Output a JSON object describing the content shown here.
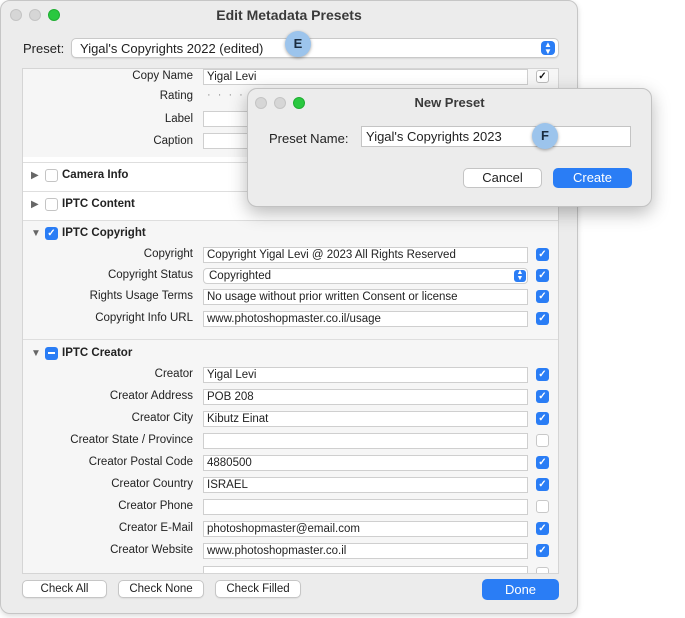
{
  "window": {
    "title": "Edit Metadata Presets"
  },
  "preset": {
    "label": "Preset:",
    "value": "Yigal's Copyrights 2022 (edited)"
  },
  "basic": {
    "copy_name": {
      "label": "Copy Name",
      "value": "Yigal Levi"
    },
    "rating": {
      "label": "Rating",
      "value": "· · · · ·"
    },
    "label": {
      "label": "Label"
    },
    "caption": {
      "label": "Caption"
    }
  },
  "sections": {
    "camera_info": "Camera Info",
    "iptc_content": "IPTC Content",
    "iptc_copyright": "IPTC Copyright",
    "iptc_creator": "IPTC Creator"
  },
  "copyright": [
    {
      "label": "Copyright",
      "value": "Copyright Yigal Levi @ 2023 All Rights Reserved",
      "checked": true
    },
    {
      "label": "Copyright Status",
      "value": "Copyrighted",
      "checked": true
    },
    {
      "label": "Rights Usage Terms",
      "value": "No usage without prior written Consent or license",
      "checked": true
    },
    {
      "label": "Copyright Info URL",
      "value": "www.photoshopmaster.co.il/usage",
      "checked": true
    }
  ],
  "creator": [
    {
      "label": "Creator",
      "value": "Yigal Levi",
      "checked": true
    },
    {
      "label": "Creator Address",
      "value": "POB 208",
      "checked": true
    },
    {
      "label": "Creator City",
      "value": "Kibutz Einat",
      "checked": true
    },
    {
      "label": "Creator State / Province",
      "value": "",
      "checked": false
    },
    {
      "label": "Creator Postal Code",
      "value": "4880500",
      "checked": true
    },
    {
      "label": "Creator Country",
      "value": "ISRAEL",
      "checked": true
    },
    {
      "label": "Creator Phone",
      "value": "",
      "checked": false
    },
    {
      "label": "Creator E-Mail",
      "value": "photoshopmaster@email.com",
      "checked": true
    },
    {
      "label": "Creator Website",
      "value": "www.photoshopmaster.co.il",
      "checked": true
    }
  ],
  "buttons": {
    "check_all": "Check All",
    "check_none": "Check None",
    "check_filled": "Check Filled",
    "done": "Done"
  },
  "dialog": {
    "title": "New Preset",
    "name_label": "Preset Name:",
    "name_value": "Yigal's Copyrights 2023",
    "cancel": "Cancel",
    "create": "Create"
  },
  "callouts": {
    "e": "E",
    "f": "F"
  },
  "colors": {
    "accent": "#2a7df5",
    "callout": "#9cc4ec",
    "traffic_green": "#2ac840"
  }
}
